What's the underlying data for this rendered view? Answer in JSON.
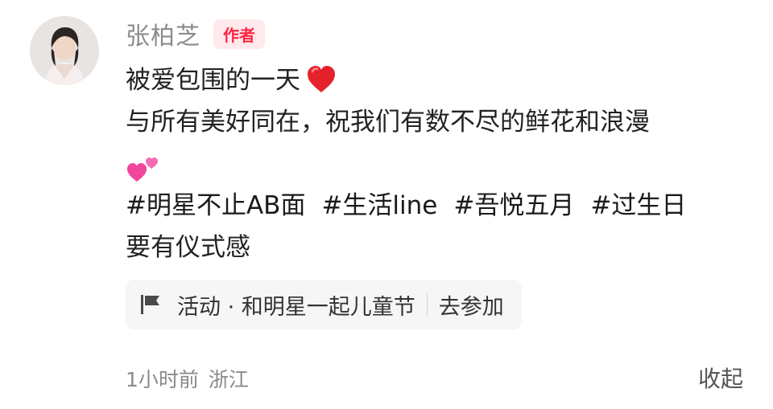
{
  "author": {
    "name": "张柏芝",
    "badge": "作者"
  },
  "post": {
    "line1": "被爱包围的一天",
    "line1_emoji": "red-heart",
    "line2": "与所有美好同在，祝我们有数不尽的鲜花和浪漫",
    "line3_emoji": "two-hearts",
    "tags_line1": [
      "#明星不止AB面",
      "#生活line",
      "#吾悦五月",
      "#过生日"
    ],
    "tags_line2": "要有仪式感"
  },
  "activity": {
    "icon": "flag-icon",
    "label": "活动 · 和明星一起儿童节",
    "action": "去参加"
  },
  "meta": {
    "time": "1小时前",
    "location": "浙江"
  },
  "collapse_label": "收起",
  "colors": {
    "badge_bg": "#ffe9ec",
    "badge_text": "#ff2442",
    "muted_text": "#8c8c8c"
  }
}
